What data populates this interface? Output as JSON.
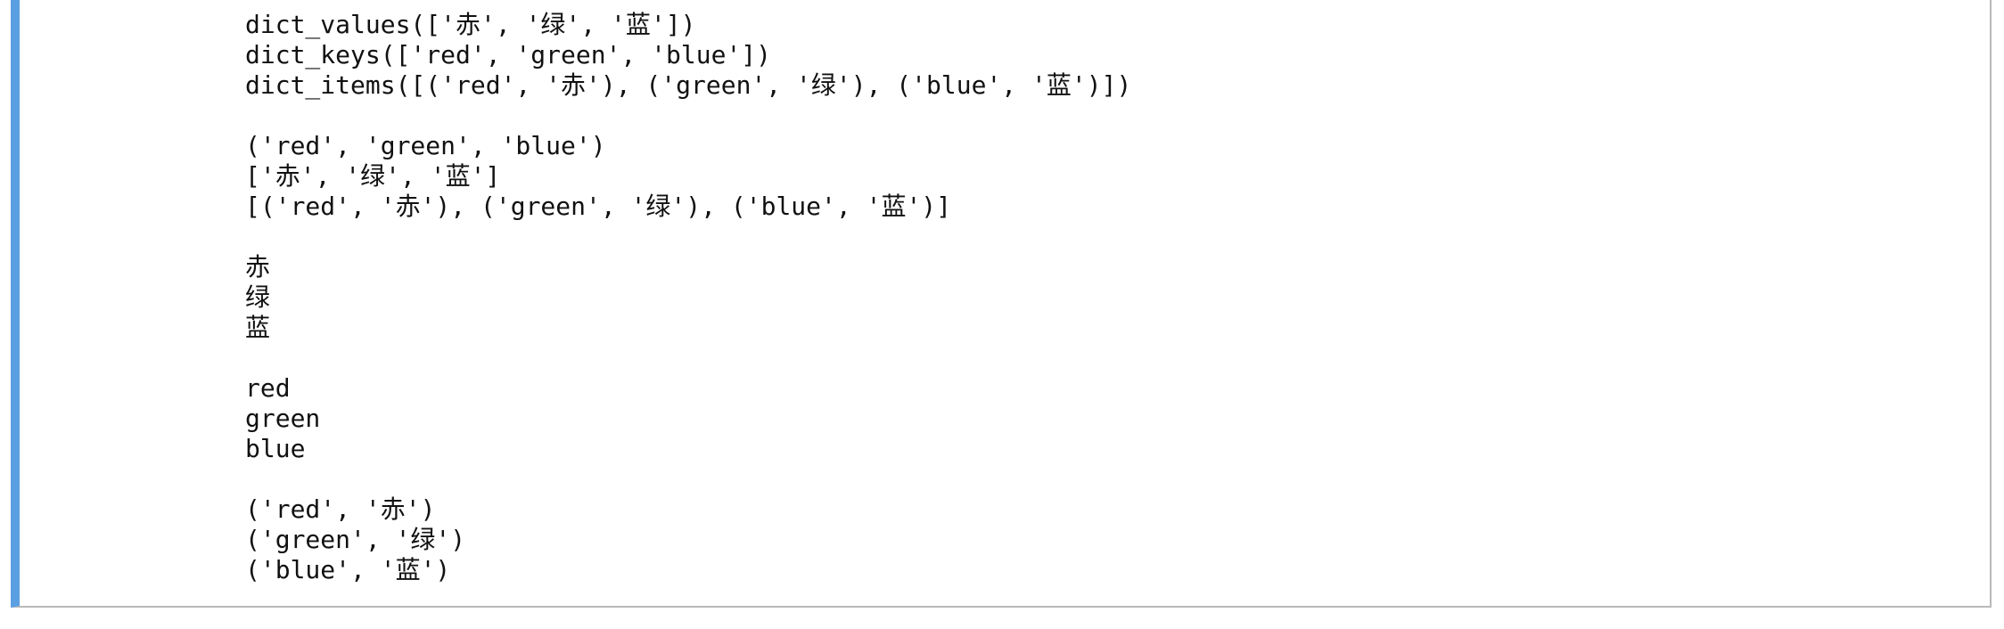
{
  "output": {
    "lines": [
      "dict_values(['赤', '绿', '蓝'])",
      "dict_keys(['red', 'green', 'blue'])",
      "dict_items([('red', '赤'), ('green', '绿'), ('blue', '蓝')])",
      "",
      "('red', 'green', 'blue')",
      "['赤', '绿', '蓝']",
      "[('red', '赤'), ('green', '绿'), ('blue', '蓝')]",
      "",
      "赤",
      "绿",
      "蓝",
      "",
      "red",
      "green",
      "blue",
      "",
      "('red', '赤')",
      "('green', '绿')",
      "('blue', '蓝')"
    ]
  }
}
